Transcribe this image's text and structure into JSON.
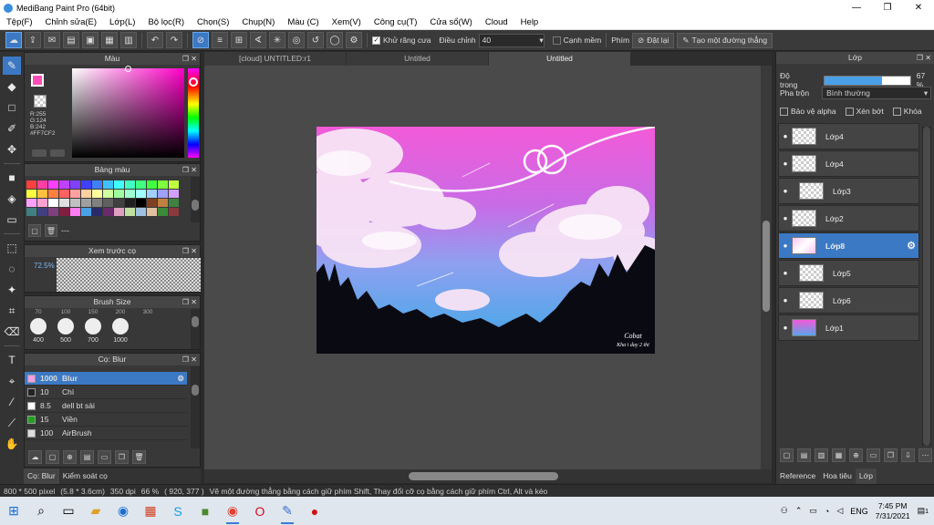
{
  "window": {
    "title": "MediBang Paint Pro (64bit)",
    "minimize": "—",
    "maximize": "❐",
    "close": "✕"
  },
  "menu": [
    "Tệp(F)",
    "Chỉnh sửa(E)",
    "Lớp(L)",
    "Bộ lọc(R)",
    "Chọn(S)",
    "Chụp(N)",
    "Màu (C)",
    "Xem(V)",
    "Công cụ(T)",
    "Cửa sổ(W)",
    "Cloud",
    "Help"
  ],
  "toolbar": {
    "antialias_label": "Khử răng cưa",
    "adjust_label": "Điều chỉnh",
    "adjust_value": "40",
    "edge_label": "Cạnh mềm",
    "key_label": "Phím",
    "reset_label": "Đặt lại",
    "line_label": "Tạo một đường thẳng"
  },
  "panels": {
    "color": {
      "title": "Màu",
      "fg_color": "#FF7CF2",
      "r": "R:255",
      "g": "G:124",
      "b": "B:242",
      "hex": "#FF7CF2"
    },
    "palette": {
      "title": "Bảng màu",
      "label": "---",
      "colors": [
        "#ff4040",
        "#ff40a0",
        "#ff40ff",
        "#c040ff",
        "#8040ff",
        "#4040ff",
        "#4080ff",
        "#40c0ff",
        "#40ffff",
        "#40ffc0",
        "#40ff80",
        "#40ff40",
        "#80ff40",
        "#c0ff40",
        "#ffff40",
        "#ffc040",
        "#ff8040",
        "#ff6060",
        "#ffa0a0",
        "#ffd0a0",
        "#ffffa0",
        "#d0ffa0",
        "#a0ffa0",
        "#a0ffd0",
        "#a0ffff",
        "#a0d0ff",
        "#a0a0ff",
        "#d0a0ff",
        "#ffa0ff",
        "#ffa0d0",
        "#ffffff",
        "#e0e0e0",
        "#c0c0c0",
        "#a0a0a0",
        "#808080",
        "#606060",
        "#404040",
        "#202020",
        "#000000",
        "#804020",
        "#c08040",
        "#408040",
        "#408080",
        "#404080",
        "#804080",
        "#802040",
        "#ff7cf2",
        "#4aa0e6",
        "#2a2a6a",
        "#6a2a6a",
        "#e0a0c0",
        "#c0e0a0",
        "#a0c0e0",
        "#e0c0a0",
        "#3a8a3a",
        "#8a3a3a"
      ]
    },
    "preview": {
      "title": "Xem trước cọ",
      "zoom": "72.5%"
    },
    "brush_size": {
      "title": "Brush Size",
      "top_sizes": [
        "70",
        "100",
        "150",
        "200",
        "300"
      ],
      "sizes": [
        "400",
        "500",
        "700",
        "1000"
      ]
    },
    "brush": {
      "title": "Cọ: Blur",
      "items": [
        {
          "size": "1000",
          "name": "Blur",
          "color": "#f0a0e0",
          "selected": true
        },
        {
          "size": "10",
          "name": "Chì",
          "color": "#222222",
          "selected": false
        },
        {
          "size": "8.5",
          "name": "dell bt sài",
          "color": "#ffffff",
          "selected": false
        },
        {
          "size": "15",
          "name": "Viền",
          "color": "#20a020",
          "selected": false
        },
        {
          "size": "100",
          "name": "AirBrush",
          "color": "#dddddd",
          "selected": false
        }
      ]
    }
  },
  "left_tabs": [
    "Cọ: Blur",
    "Kiểm soát cọ"
  ],
  "doc_tabs": [
    {
      "label": "[cloud] UNTITLED:r1",
      "active": false
    },
    {
      "label": "Untitled",
      "active": false
    },
    {
      "label": "Untitled",
      "active": true
    }
  ],
  "artwork": {
    "signature_line1": "Cobat",
    "signature_line2": "Kha i day 2 thi"
  },
  "layers_panel": {
    "title": "Lớp",
    "opacity_label": "Độ trong",
    "opacity_value": "67 %",
    "opacity_fraction": 0.67,
    "blend_label": "Pha trộn",
    "blend_value": "Bình thường",
    "protect_alpha": "Bảo vệ alpha",
    "clipping": "Xén bớt",
    "lock": "Khóa",
    "layers": [
      {
        "name": "Lớp4",
        "indent": false,
        "selected": false
      },
      {
        "name": "Lớp4",
        "indent": false,
        "selected": false
      },
      {
        "name": "Lớp3",
        "indent": true,
        "selected": false
      },
      {
        "name": "Lớp2",
        "indent": false,
        "selected": false
      },
      {
        "name": "Lớp8",
        "indent": false,
        "selected": true
      },
      {
        "name": "Lớp5",
        "indent": true,
        "selected": false
      },
      {
        "name": "Lớp6",
        "indent": true,
        "selected": false
      },
      {
        "name": "Lớp1",
        "indent": false,
        "selected": false
      }
    ],
    "tabs": [
      "Reference",
      "Hoa tiêu",
      "Lớp"
    ]
  },
  "status": {
    "pixels": "800 * 500 pixel",
    "cm": "(5.8 * 3.6cm)",
    "dpi": "350 dpi",
    "zoom": "66 %",
    "coords": "( 920, 377 )",
    "hint": "Vẽ một đường thẳng bằng cách giữ phím Shift, Thay đổi cỡ cọ bằng cách giữ phím Ctrl, Alt và kéo"
  },
  "taskbar": {
    "language": "ENG",
    "time": "7:45 PM",
    "date": "7/31/2021",
    "notifications": "1"
  }
}
